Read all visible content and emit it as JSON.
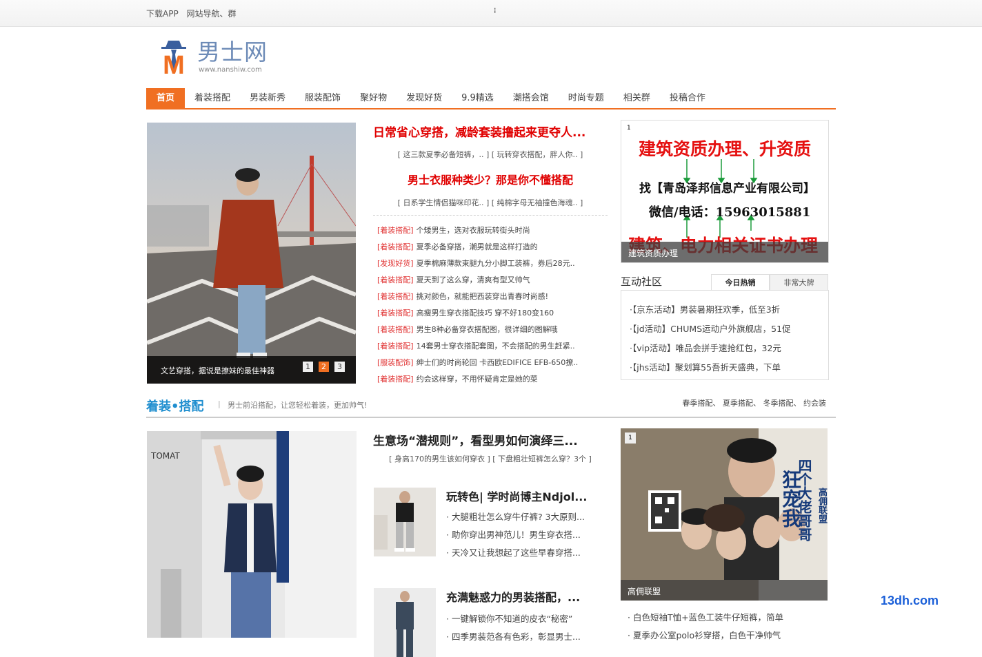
{
  "topbar": {
    "download_app": "下载APP",
    "site_nav": "网站导航、群",
    "spinner": "⁞"
  },
  "logo": {
    "name": "男士网",
    "domain": "www.nanshiw.com",
    "letter": "M"
  },
  "nav": [
    "首页",
    "着装搭配",
    "男装新秀",
    "服装配饰",
    "聚好物",
    "发现好货",
    "9.9精选",
    "潮搭会馆",
    "时尚专题",
    "相关群",
    "投稿合作"
  ],
  "hero": {
    "caption": "文艺穿搭，据说是撩妹的最佳神器",
    "pages": [
      "1",
      "2",
      "3"
    ],
    "active_page": "2"
  },
  "headline": {
    "title1": "日常省心穿搭，减龄套装撸起来更夺人...",
    "sub1": "[ 这三款夏季必备短裤，.. ]   [ 玩转穿衣搭配，胖人你.. ]",
    "title2": "男士衣服种类少？那是你不懂搭配",
    "sub2": "[ 日系学生情侣猫咪印花.. ]   [ 纯棉字母无袖撞色海魂.. ]"
  },
  "news": [
    {
      "tag": "[着装搭配]",
      "text": "个矮男生，选对衣服玩转街头时尚"
    },
    {
      "tag": "[着装搭配]",
      "text": "夏季必备穿搭，潮男就是这样打造的"
    },
    {
      "tag": "[发现好货]",
      "text": "夏季棉麻薄款束腿九分小脚工装裤，券后28元.."
    },
    {
      "tag": "[着装搭配]",
      "text": "夏天到了这么穿，清爽有型又帅气"
    },
    {
      "tag": "[着装搭配]",
      "text": "挑对颜色，就能把西装穿出青春时尚感!"
    },
    {
      "tag": "[着装搭配]",
      "text": "高瘦男生穿衣搭配技巧 穿不好180变160"
    },
    {
      "tag": "[着装搭配]",
      "text": "男生8种必备穿衣搭配图，很详细的图解哦"
    },
    {
      "tag": "[着装搭配]",
      "text": "14套男士穿衣搭配套图，不会搭配的男生赶紧.."
    },
    {
      "tag": "[服装配饰]",
      "text": "绅士们的时尚轮回 卡西欧EDIFICE EFB-650撩.."
    },
    {
      "tag": "[着装搭配]",
      "text": "约会这样穿，不用怀疑肯定是她的菜"
    }
  ],
  "ad1": {
    "num": "1",
    "line1": "建筑资质办理、升资质",
    "line2": "找【青岛泽邦信息产业有限公司】",
    "line3": "微信/电话：15963015881",
    "line4": "建筑、电力相关证书办理",
    "bar": "建筑资质办理"
  },
  "community": {
    "title": "互动社区",
    "tabs": [
      "今日热销",
      "非常大牌"
    ],
    "items": [
      "·【京东活动】男装暑期狂欢季，低至3折",
      "·【jd活动】CHUMS运动户外旗舰店，51促",
      "·【vip活动】唯品会拼手速抢红包，32元",
      "·【jhs活动】聚划算55吾折天盛典，下单"
    ]
  },
  "section": {
    "title": "着装•搭配",
    "sep": "|",
    "desc": "男士前沿搭配，让您轻松着装，更加帅气!",
    "links": "春季搭配、 夏季搭配、 冬季搭配、 约会装"
  },
  "second": {
    "title": "生意场“潜规则”，看型男如何演绎三...",
    "sub": "[ 身高170的男生该如何穿衣 ]   [ 下盘粗壮短裤怎么穿？3个 ]",
    "card1": {
      "title": "玩转色| 学时尚博主Ndjol...",
      "items": [
        "· 大腿粗壮怎么穿牛仔裤? 3大原则...",
        "· 助你穿出男神范儿！男生穿衣搭...",
        "· 天冷又让我想起了这些早春穿搭..."
      ]
    },
    "card2": {
      "title": "充满魅惑力的男装搭配，...",
      "items": [
        "· 一键解锁你不知道的皮衣“秘密”",
        "· 四季男装范各有色彩，彰显男士..."
      ]
    }
  },
  "ad2": {
    "num": "1",
    "bar": "高佣联盟",
    "vt1": "四个大佬哥哥",
    "vt2": "狂宠我",
    "brand": "高佣联盟"
  },
  "list3": [
    "· 白色短袖T恤+蓝色工装牛仔短裤，简单",
    "· 夏季办公室polo衫穿搭，白色干净帅气"
  ],
  "watermark": "13dh.com",
  "colors": {
    "accent": "#f06f22",
    "headline_red": "#e00000",
    "section_blue": "#1f8ecf"
  }
}
